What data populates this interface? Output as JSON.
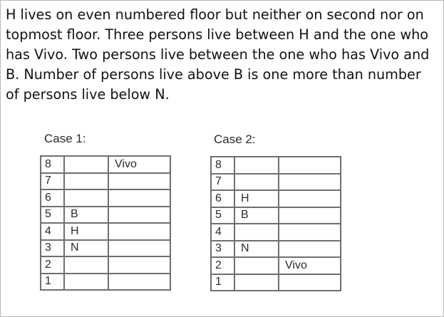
{
  "paragraph": [
    "H lives on even numbered floor but neither on second nor on",
    "topmost floor. Three persons live between H and the one who",
    "has Vivo. Two persons live between the one who has Vivo and",
    "B. Number of persons live above B is one more than number",
    "of persons live below N."
  ],
  "cases": [
    {
      "title": "Case 1:",
      "rows": [
        {
          "floor": "8",
          "person": "",
          "phone": "Vivo"
        },
        {
          "floor": "7",
          "person": "",
          "phone": ""
        },
        {
          "floor": "6",
          "person": "",
          "phone": ""
        },
        {
          "floor": "5",
          "person": "B",
          "phone": ""
        },
        {
          "floor": "4",
          "person": "H",
          "phone": ""
        },
        {
          "floor": "3",
          "person": "N",
          "phone": ""
        },
        {
          "floor": "2",
          "person": "",
          "phone": ""
        },
        {
          "floor": "1",
          "person": "",
          "phone": ""
        }
      ]
    },
    {
      "title": "Case 2:",
      "rows": [
        {
          "floor": "8",
          "person": "",
          "phone": ""
        },
        {
          "floor": "7",
          "person": "",
          "phone": ""
        },
        {
          "floor": "6",
          "person": "H",
          "phone": ""
        },
        {
          "floor": "5",
          "person": "B",
          "phone": ""
        },
        {
          "floor": "4",
          "person": "",
          "phone": ""
        },
        {
          "floor": "3",
          "person": "N",
          "phone": ""
        },
        {
          "floor": "2",
          "person": "",
          "phone": "Vivo"
        },
        {
          "floor": "1",
          "person": "",
          "phone": ""
        }
      ]
    }
  ]
}
